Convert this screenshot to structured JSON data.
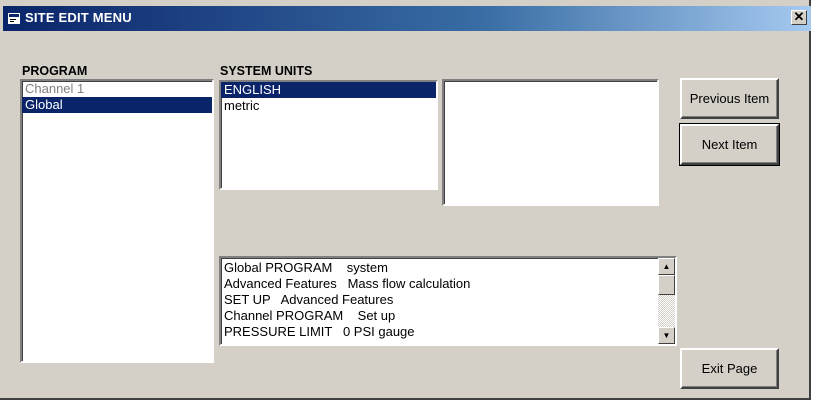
{
  "window": {
    "title": "SITE EDIT MENU",
    "close_glyph": "✕"
  },
  "program": {
    "label": "PROGRAM",
    "items": [
      {
        "text": "Channel 1",
        "selected": false
      },
      {
        "text": "Global",
        "selected": true
      }
    ]
  },
  "system_units": {
    "label": "SYSTEM UNITS",
    "items": [
      {
        "text": "ENGLISH",
        "selected": true
      },
      {
        "text": "metric",
        "selected": false
      }
    ]
  },
  "buttons": {
    "previous": "Previous Item",
    "next": "Next Item",
    "exit": "Exit Page"
  },
  "status_lines": [
    "Global PROGRAM    system",
    "Advanced Features   Mass flow calculation",
    "SET UP   Advanced Features",
    "Channel PROGRAM    Set up",
    "PRESSURE LIMIT   0 PSI gauge"
  ],
  "icons": {
    "title_icon": "window-app-icon",
    "scroll_up": "scroll-up-icon",
    "scroll_down": "scroll-down-icon"
  },
  "colors": {
    "selection": "#0a246a",
    "title_start": "#0a246a",
    "face": "#d4d0c8"
  }
}
